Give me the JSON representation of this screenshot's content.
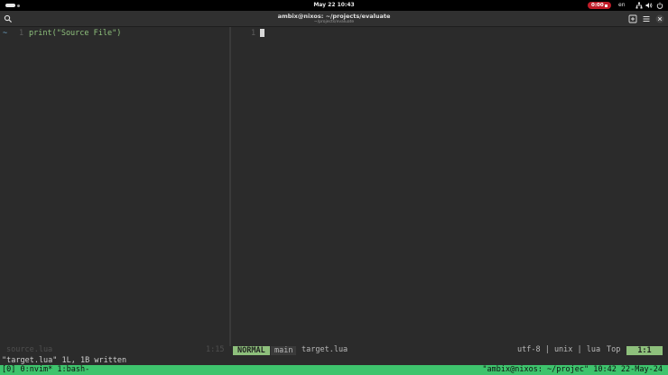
{
  "topbar": {
    "clock": "May 22  10:43",
    "recording_time": "0:00",
    "language": "en",
    "icons": [
      "network-icon",
      "volume-icon",
      "power-icon"
    ]
  },
  "window": {
    "title": "ambix@nixos: ~/projects/evaluate",
    "subtitle": "~/projects/evaluate",
    "buttons": [
      "new-tab-icon",
      "menu-icon",
      "close-icon"
    ]
  },
  "editor": {
    "left_pane": {
      "sign": "~",
      "line_number": "1",
      "code": "print(\"Source File\")",
      "filename": "source.lua",
      "position": "1:15"
    },
    "right_pane": {
      "line_number": "1",
      "mode": "NORMAL",
      "branch": "main",
      "filename": "target.lua",
      "fileinfo": "utf-8 | unix | lua",
      "scroll": "Top",
      "position": "1:1"
    },
    "command_line": "\"target.lua\" 1L, 1B written"
  },
  "tmux": {
    "left": "[0] 0:nvim* 1:bash-",
    "right": "\"ambix@nixos: ~/projec\" 10:42 22-May-24"
  },
  "colors": {
    "background": "#2b2b2b",
    "accent_green": "#8ec07c",
    "tmux_green": "#3ec46d",
    "record_red": "#c01c28"
  }
}
